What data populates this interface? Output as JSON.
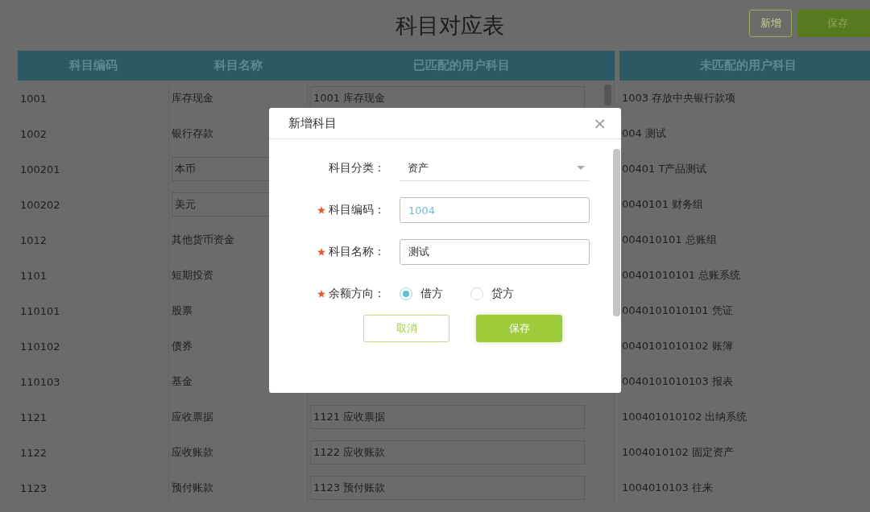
{
  "page": {
    "title": "科目对应表",
    "buttons": [
      {
        "label": "新增",
        "kind": "outline"
      },
      {
        "label": "保存",
        "kind": "primary"
      }
    ]
  },
  "mapping_table": {
    "columns": [
      "科目编码",
      "科目名称",
      "已匹配的用户科目"
    ],
    "rows": [
      {
        "code": "1001",
        "name": "库存现金",
        "name_boxed": false,
        "matched": "1001 库存现金"
      },
      {
        "code": "1002",
        "name": "银行存款",
        "name_boxed": false
      },
      {
        "code": "100201",
        "name": "本币",
        "name_boxed": true
      },
      {
        "code": "100202",
        "name": "美元",
        "name_boxed": true
      },
      {
        "code": "1012",
        "name": "其他货币资金",
        "name_boxed": false
      },
      {
        "code": "1101",
        "name": "短期投资",
        "name_boxed": false
      },
      {
        "code": "110101",
        "name": "股票",
        "name_boxed": false
      },
      {
        "code": "110102",
        "name": "债券",
        "name_boxed": false
      },
      {
        "code": "110103",
        "name": "基金",
        "name_boxed": false
      },
      {
        "code": "1121",
        "name": "应收票据",
        "name_boxed": false,
        "matched": "1121 应收票据"
      },
      {
        "code": "1122",
        "name": "应收账款",
        "name_boxed": false,
        "matched": "1122 应收账款"
      },
      {
        "code": "1123",
        "name": "预付账款",
        "name_boxed": false,
        "matched": "1123 预付账款"
      }
    ]
  },
  "unmatched_table": {
    "columns": [
      "未匹配的用户科目"
    ],
    "rows": [
      "1003 存放中央银行款项",
      "004 测试",
      "00401 T产品测试",
      "0040101 财务组",
      "004010101 总账组",
      "00401010101 总账系统",
      "0040101010101 凭证",
      "0040101010102 账簿",
      "0040101010103 报表",
      "100401010102 出纳系统",
      "1004010102 固定资产",
      "1004010103 往来"
    ]
  },
  "dialog": {
    "title": "新增科目",
    "close": "×",
    "fields": [
      {
        "kind": "select",
        "label": "科目分类：",
        "required": false,
        "value": "资产"
      },
      {
        "kind": "text",
        "label": "科目编码：",
        "required": true,
        "value": "1004",
        "generated": true
      },
      {
        "kind": "text",
        "label": "科目名称：",
        "required": true,
        "value": "测试",
        "generated": false
      },
      {
        "kind": "radio",
        "label": "余额方向：",
        "required": true,
        "options": [
          {
            "label": "借方",
            "selected": true
          },
          {
            "label": "贷方",
            "selected": false
          }
        ]
      }
    ],
    "buttons": [
      {
        "label": "取消",
        "kind": "outline"
      },
      {
        "label": "保存",
        "kind": "primary"
      }
    ]
  }
}
